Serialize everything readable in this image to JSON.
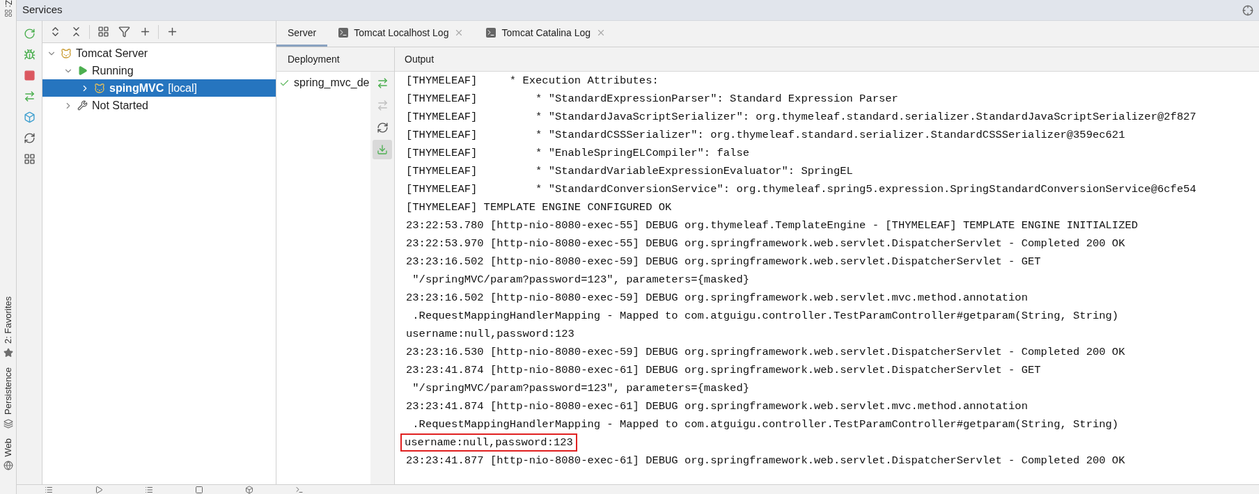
{
  "left_strip": {
    "top_label": "Z:",
    "items": [
      {
        "label": "2: Favorites",
        "kind": "star"
      },
      {
        "label": "Persistence",
        "kind": "persistence"
      },
      {
        "label": "Web",
        "kind": "web"
      }
    ]
  },
  "window": {
    "title": "Services"
  },
  "tree": [
    {
      "label": "Tomcat Server",
      "kind": "server",
      "expanded": true,
      "children": [
        {
          "label": "Running",
          "kind": "running",
          "expanded": true,
          "children": [
            {
              "label": "spingMVC",
              "suffix": "[local]",
              "kind": "app",
              "selected": true,
              "expanded": false
            }
          ]
        },
        {
          "label": "Not Started",
          "kind": "stopped",
          "expanded": false,
          "selected": false
        }
      ]
    }
  ],
  "tabs": [
    {
      "label": "Server",
      "selected": true,
      "closable": false
    },
    {
      "label": "Tomcat Localhost Log",
      "selected": false,
      "closable": true
    },
    {
      "label": "Tomcat Catalina Log",
      "selected": false,
      "closable": true
    }
  ],
  "deployment": {
    "header": "Deployment",
    "items": [
      {
        "label": "spring_mvc_de",
        "deployed": true
      }
    ]
  },
  "output": {
    "header": "Output",
    "lines": [
      {
        "text": "[THYMELEAF]     * Execution Attributes:",
        "highlighted": false
      },
      {
        "text": "[THYMELEAF]         * \"StandardExpressionParser\": Standard Expression Parser",
        "highlighted": false
      },
      {
        "text": "[THYMELEAF]         * \"StandardJavaScriptSerializer\": org.thymeleaf.standard.serializer.StandardJavaScriptSerializer@2f827",
        "highlighted": false
      },
      {
        "text": "[THYMELEAF]         * \"StandardCSSSerializer\": org.thymeleaf.standard.serializer.StandardCSSSerializer@359ec621",
        "highlighted": false
      },
      {
        "text": "[THYMELEAF]         * \"EnableSpringELCompiler\": false",
        "highlighted": false
      },
      {
        "text": "[THYMELEAF]         * \"StandardVariableExpressionEvaluator\": SpringEL",
        "highlighted": false
      },
      {
        "text": "[THYMELEAF]         * \"StandardConversionService\": org.thymeleaf.spring5.expression.SpringStandardConversionService@6cfe54",
        "highlighted": false
      },
      {
        "text": "[THYMELEAF] TEMPLATE ENGINE CONFIGURED OK",
        "highlighted": false
      },
      {
        "text": "23:22:53.780 [http-nio-8080-exec-55] DEBUG org.thymeleaf.TemplateEngine - [THYMELEAF] TEMPLATE ENGINE INITIALIZED",
        "highlighted": false
      },
      {
        "text": "23:22:53.970 [http-nio-8080-exec-55] DEBUG org.springframework.web.servlet.DispatcherServlet - Completed 200 OK",
        "highlighted": false
      },
      {
        "text": "23:23:16.502 [http-nio-8080-exec-59] DEBUG org.springframework.web.servlet.DispatcherServlet - GET",
        "highlighted": false
      },
      {
        "text": " \"/springMVC/param?password=123\", parameters={masked}",
        "highlighted": false
      },
      {
        "text": "23:23:16.502 [http-nio-8080-exec-59] DEBUG org.springframework.web.servlet.mvc.method.annotation",
        "highlighted": false
      },
      {
        "text": " .RequestMappingHandlerMapping - Mapped to com.atguigu.controller.TestParamController#getparam(String, String)",
        "highlighted": false
      },
      {
        "text": "username:null,password:123",
        "highlighted": false
      },
      {
        "text": "23:23:16.530 [http-nio-8080-exec-59] DEBUG org.springframework.web.servlet.DispatcherServlet - Completed 200 OK",
        "highlighted": false
      },
      {
        "text": "23:23:41.874 [http-nio-8080-exec-61] DEBUG org.springframework.web.servlet.DispatcherServlet - GET",
        "highlighted": false
      },
      {
        "text": " \"/springMVC/param?password=123\", parameters={masked}",
        "highlighted": false
      },
      {
        "text": "23:23:41.874 [http-nio-8080-exec-61] DEBUG org.springframework.web.servlet.mvc.method.annotation",
        "highlighted": false
      },
      {
        "text": " .RequestMappingHandlerMapping - Mapped to com.atguigu.controller.TestParamController#getparam(String, String)",
        "highlighted": false
      },
      {
        "text": "username:null,password:123",
        "highlighted": true
      },
      {
        "text": "23:23:41.877 [http-nio-8080-exec-61] DEBUG org.springframework.web.servlet.DispatcherServlet - Completed 200 OK",
        "highlighted": false
      }
    ]
  }
}
